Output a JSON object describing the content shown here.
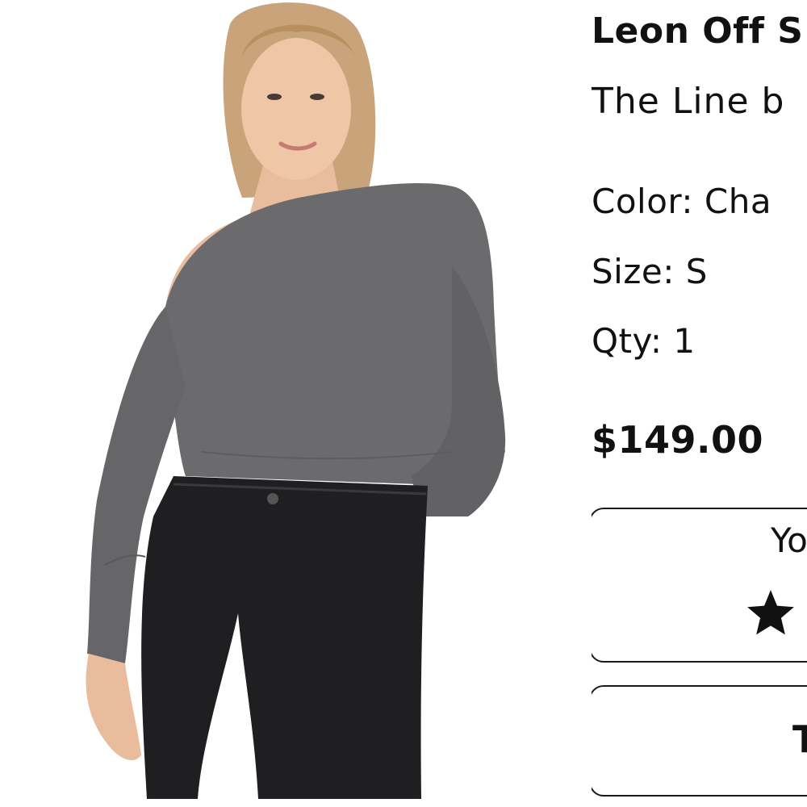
{
  "product": {
    "title": "Leon Off S",
    "brand": "The Line b",
    "color_line": "Color: Cha",
    "size_line": "Size: S",
    "qty_line": "Qty: 1",
    "price": "$149.00"
  },
  "review": {
    "label": "Yo",
    "rating": 1
  },
  "action": {
    "label": "T"
  },
  "colors": {
    "sweater": "#6b6a6c",
    "jeans": "#1f1f21",
    "skin": "#e8bc9c",
    "hair": "#c9a37a",
    "border": "#1a1a1a"
  }
}
